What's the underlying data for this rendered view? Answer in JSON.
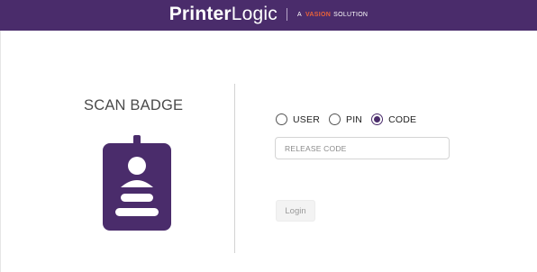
{
  "header": {
    "brand_strong": "Printer",
    "brand_light": "Logic",
    "tagline_prefix": "A",
    "tagline_vision": "VASION",
    "tagline_suffix": "SOLUTION",
    "background_color": "#4a2c6b",
    "accent_color": "#e8623a"
  },
  "left_panel": {
    "title": "SCAN BADGE",
    "icon": "id-badge-icon"
  },
  "login_form": {
    "options": [
      {
        "label": "USER",
        "checked": false
      },
      {
        "label": "PIN",
        "checked": false
      },
      {
        "label": "CODE",
        "checked": true
      }
    ],
    "code_placeholder": "RELEASE CODE",
    "code_value": "",
    "login_label": "Login"
  }
}
